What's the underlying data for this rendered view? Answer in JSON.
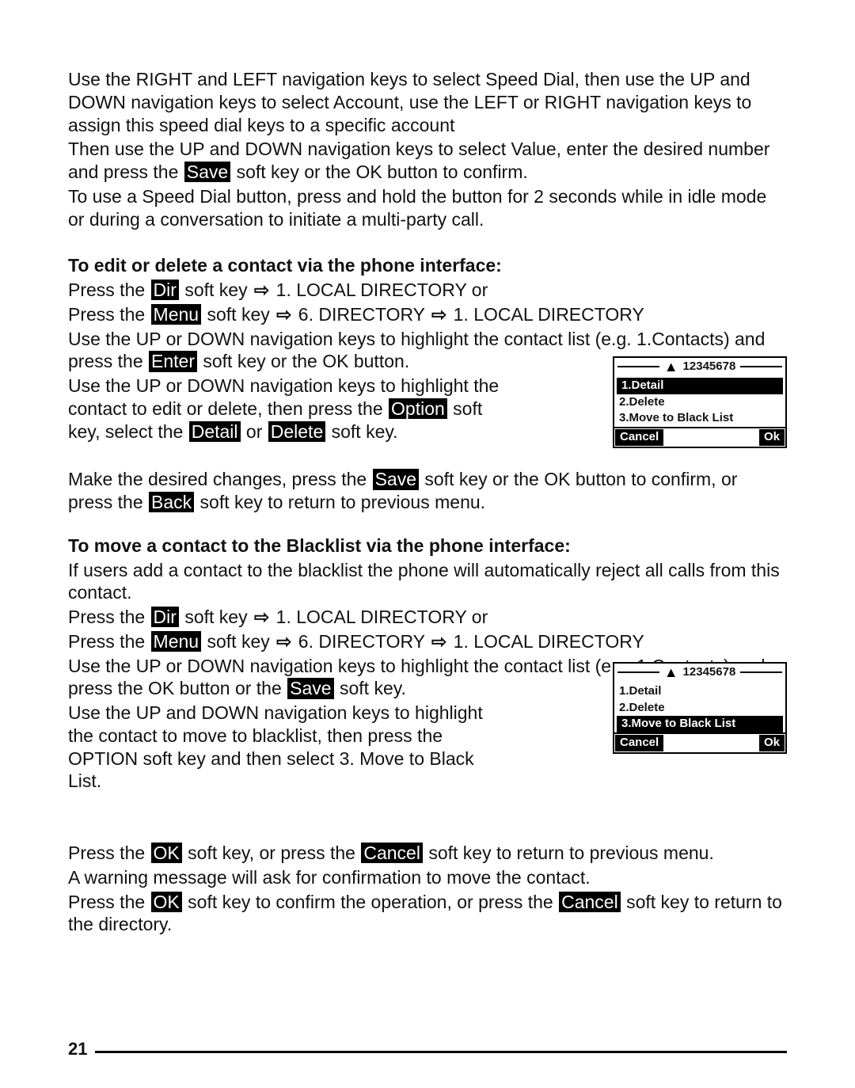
{
  "intro": {
    "p1": "Use the RIGHT and LEFT navigation keys to select Speed Dial, then use the UP and DOWN navigation keys to select Account, use the LEFT or RIGHT navigation keys to assign this speed dial keys to a specific account",
    "p2a": "Then use the UP and DOWN navigation keys to select Value, enter the desired number and press the ",
    "save": "Save",
    "p2b": " soft key or the OK button to confirm.",
    "p3": "To use a Speed Dial button, press and hold the button for 2 seconds while in idle mode or during a conversation to initiate a multi-party call."
  },
  "sec1": {
    "heading": "To edit or delete a contact via the phone interface:",
    "l1a": "Press the ",
    "dir": "Dir",
    "l1b": " soft key ",
    "l1c": " 1. LOCAL DIRECTORY  or",
    "l2a": "Press the ",
    "menu": "Menu",
    "l2b": " soft key  ",
    "l2c": " 6. DIRECTORY ",
    "l2d": " 1.  LOCAL DIRECTORY",
    "l3a": "Use the UP or DOWN navigation keys to highlight the contact list (e.g. 1.Contacts) and press the ",
    "enter": "Enter",
    "l3b": " soft key or the OK button.",
    "l4a": "Use the UP or DOWN navigation keys to highlight the contact to edit or delete, then press the ",
    "option": "Option",
    "l4b": " soft key, select the ",
    "detail": "Detail",
    "or": " or ",
    "delete": "Delete",
    "l4c": " soft key.",
    "l5a": "Make the desired changes, press the ",
    "save2": "Save",
    "l5b": " soft key or the OK button to confirm, or press the ",
    "back": "Back",
    "l5c": " soft key to return to previous menu."
  },
  "screen1": {
    "title": "12345678",
    "row1": "1.Detail",
    "row2": "2.Delete",
    "row3": "3.Move to Black List",
    "soft_left": "Cancel",
    "soft_right": "Ok"
  },
  "sec2": {
    "heading": "To move a contact to the Blacklist via the phone interface:",
    "l1": "If users add a contact to the blacklist the phone will automatically reject all calls from this contact.",
    "l2a": "Press the ",
    "dir": "Dir",
    "l2b": " soft key ",
    "l2c": " 1. LOCAL DIRECTORY  or",
    "l3a": "Press the ",
    "menu": "Menu",
    "l3b": " soft key ",
    "l3c": " 6. DIRECTORY ",
    "l3d": " 1. LOCAL DIRECTORY",
    "l4a": "Use the UP or DOWN navigation keys to highlight the contact list (e.g. 1.Contacts) and press the OK button or the ",
    "save": "Save",
    "l4b": " soft key.",
    "l5": "Use the UP and DOWN navigation keys to highlight the contact to move to blacklist, then press the OPTION soft key and then select 3. Move to Black List."
  },
  "screen2": {
    "title": "12345678",
    "row1": "1.Detail",
    "row2": "2.Delete",
    "row3": "3.Move to Black List",
    "soft_left": "Cancel",
    "soft_right": "Ok"
  },
  "sec3": {
    "l1a": "Press the ",
    "ok1": "OK",
    "l1b": " soft key, or press the ",
    "cancel1": "Cancel",
    "l1c": " soft key to return to previous menu.",
    "l2": "A warning message will ask for confirmation to move the contact.",
    "l3a": "Press the ",
    "ok2": "OK",
    "l3b": " soft key to confirm the operation, or press the ",
    "cancel2": "Cancel",
    "l3c": " soft key to return to the directory."
  },
  "page_number": "21"
}
